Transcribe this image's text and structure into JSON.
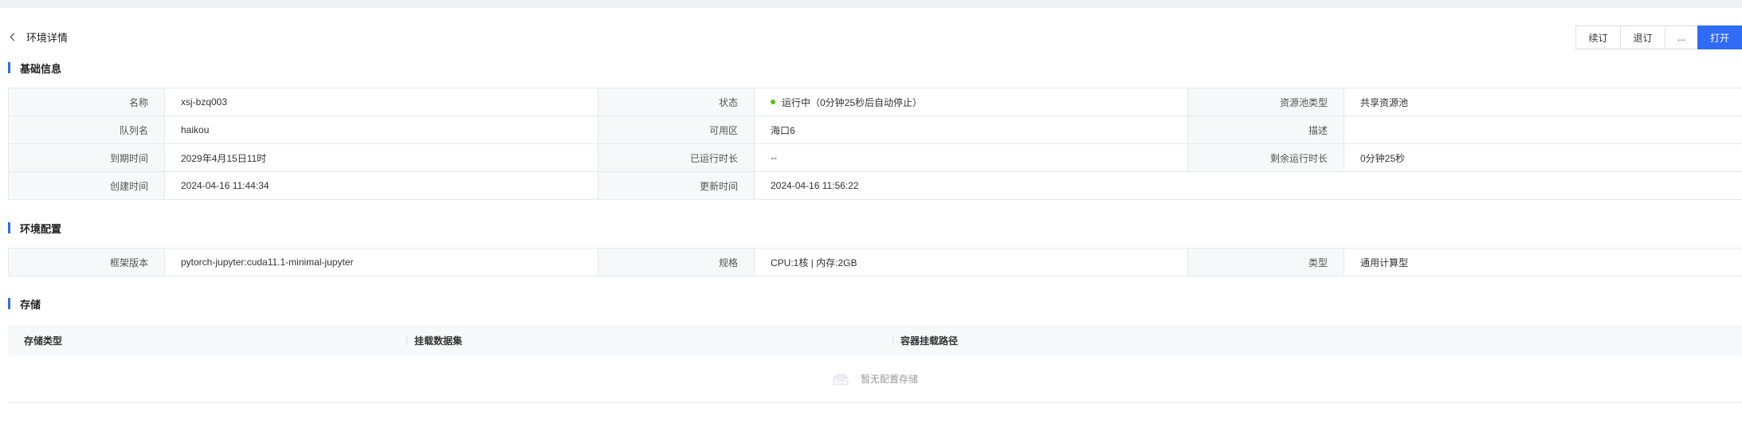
{
  "header": {
    "title": "环境详情",
    "actions": {
      "renew": "续订",
      "unsubscribe": "退订",
      "more": "...",
      "open": "打开"
    }
  },
  "sections": {
    "basic": "基础信息",
    "config": "环境配置",
    "storage": "存储"
  },
  "basic_info": {
    "rows": [
      [
        {
          "label": "名称",
          "value": "xsj-bzq003"
        },
        {
          "label": "状态",
          "value": "运行中（0分钟25秒后自动停止）"
        },
        {
          "label": "资源池类型",
          "value": "共享资源池"
        }
      ],
      [
        {
          "label": "队列名",
          "value": "haikou"
        },
        {
          "label": "可用区",
          "value": "海口6"
        },
        {
          "label": "描述",
          "value": ""
        }
      ],
      [
        {
          "label": "到期时间",
          "value": "2029年4月15日11时"
        },
        {
          "label": "已运行时长",
          "value": "--"
        },
        {
          "label": "剩余运行时长",
          "value": "0分钟25秒"
        }
      ],
      [
        {
          "label": "创建时间",
          "value": "2024-04-16 11:44:34"
        },
        {
          "label": "更新时间",
          "value": "2024-04-16 11:56:22"
        }
      ]
    ],
    "status_color": "#52c41a"
  },
  "env_config": {
    "rows": [
      [
        {
          "label": "框架版本",
          "value": "pytorch-jupyter:cuda11.1-minimal-jupyter"
        },
        {
          "label": "规格",
          "value": "CPU:1核 | 内存:2GB"
        },
        {
          "label": "类型",
          "value": "通用计算型"
        }
      ]
    ]
  },
  "storage": {
    "columns": [
      "存储类型",
      "挂载数据集",
      "容器挂载路径"
    ],
    "empty_text": "暂无配置存储"
  },
  "colors": {
    "primary": "#2f6bf6",
    "label_bg": "#f7f8fa",
    "border": "#e6e8eb"
  }
}
